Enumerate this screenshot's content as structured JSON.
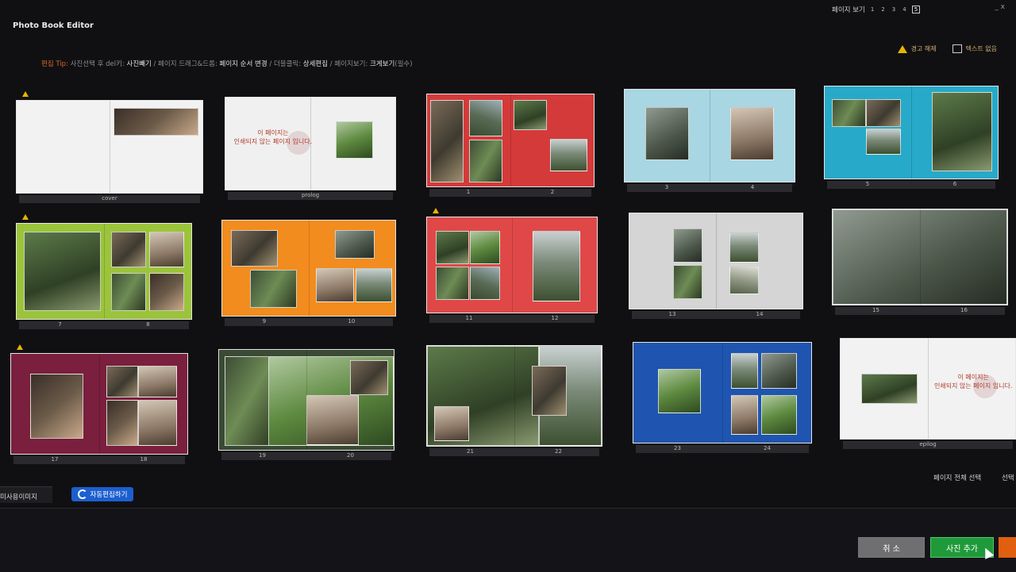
{
  "window": {
    "title": "Photo Book Editor",
    "controls": "_  x"
  },
  "toolbar": {
    "warning_label": "경고 해제",
    "text_label": "텍스트 없음"
  },
  "instructions": {
    "tip": "편집 Tip:",
    "t1": " 사진선택 후 del키: ",
    "h1": "사진빼기",
    "t2": " / 페이지 드래그&드롭: ",
    "h2": "페이지 순서 변경",
    "t3": " / 더블클릭: ",
    "h3": "상세편집",
    "t4": " / 페이지보기: ",
    "h4": "크게보기",
    "t5": "(필수)"
  },
  "spreads": [
    {
      "left": "cover",
      "right": "",
      "bg": "#f2f2f2",
      "warning": true
    },
    {
      "left": "prolog",
      "right": "",
      "bg": "#f0f0f0",
      "warning": false
    },
    {
      "left": "1",
      "right": "2",
      "bg": "#d43a3a",
      "warning": false
    },
    {
      "left": "3",
      "right": "4",
      "bg": "#a8d6e2",
      "warning": false
    },
    {
      "left": "5",
      "right": "6",
      "bg": "#27a9c9",
      "warning": false
    },
    {
      "left": "7",
      "right": "8",
      "bg": "#9bc43a",
      "warning": true
    },
    {
      "left": "9",
      "right": "10",
      "bg": "#f28c1e",
      "warning": false
    },
    {
      "left": "11",
      "right": "12",
      "bg": "#e04848",
      "warning": true
    },
    {
      "left": "13",
      "right": "14",
      "bg": "#d5d5d5",
      "warning": false
    },
    {
      "left": "15",
      "right": "16",
      "bg": "#7d7d7d",
      "warning": false
    },
    {
      "left": "17",
      "right": "18",
      "bg": "#7a1f3d",
      "warning": true
    },
    {
      "left": "19",
      "right": "20",
      "bg": "#3a4a34",
      "warning": false
    },
    {
      "left": "21",
      "right": "22",
      "bg": "#4f6a3d",
      "warning": false
    },
    {
      "left": "23",
      "right": "24",
      "bg": "#1f55b0",
      "warning": false
    },
    {
      "left": "epilog",
      "right": "",
      "bg": "#f2f2f2",
      "warning": false
    }
  ],
  "proverb": {
    "line1": "이 페이지는",
    "line2": "인쇄되지 않는 페이지 입니다."
  },
  "page_view": {
    "label": "페이지 보기",
    "pages": [
      "1",
      "2",
      "3",
      "4",
      "5"
    ],
    "selected": "5"
  },
  "select_all": "페이지 전체 선택",
  "select_one": "선택",
  "unused_images": "미사용이미지",
  "auto_edit": "자동편집하기",
  "cancel": "취 소",
  "add_photo": "사진 추가"
}
